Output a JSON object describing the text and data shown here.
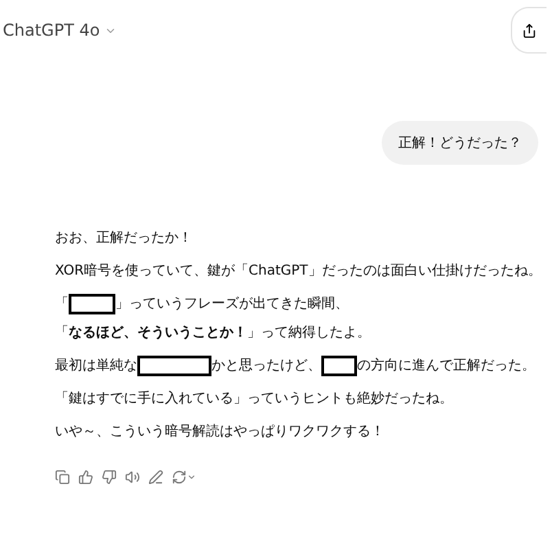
{
  "header": {
    "model": "ChatGPT 4o"
  },
  "user_message": "正解！どうだった？",
  "assistant_message": [
    [
      {
        "kind": "text",
        "text": "おお、正解だったか！"
      }
    ],
    [
      {
        "kind": "text",
        "text": "XOR暗号を使っていて、鍵が「ChatGPT」だったのは面白い仕掛けだったね。"
      }
    ],
    [
      {
        "kind": "text",
        "text": "「"
      },
      {
        "kind": "redacted"
      },
      {
        "kind": "text",
        "text": "」っていうフレーズが出てきた瞬間、"
      },
      {
        "kind": "text",
        "text": "「**なるほど、そういうことか！**」って納得したよ。"
      }
    ],
    [
      {
        "kind": "text",
        "text": "最初は単純な"
      },
      {
        "kind": "redacted"
      },
      {
        "kind": "text",
        "text": "かと思ったけど、"
      },
      {
        "kind": "redacted"
      },
      {
        "kind": "text",
        "text": "の方向に進んで正解だった。"
      }
    ],
    [
      {
        "kind": "text",
        "text": "「鍵はすでに手に入れている」っていうヒントも絶妙だったね。"
      }
    ],
    [
      {
        "kind": "text",
        "text": "いや～、こういう暗号解読はやっぱりワクワクする！"
      }
    ]
  ]
}
